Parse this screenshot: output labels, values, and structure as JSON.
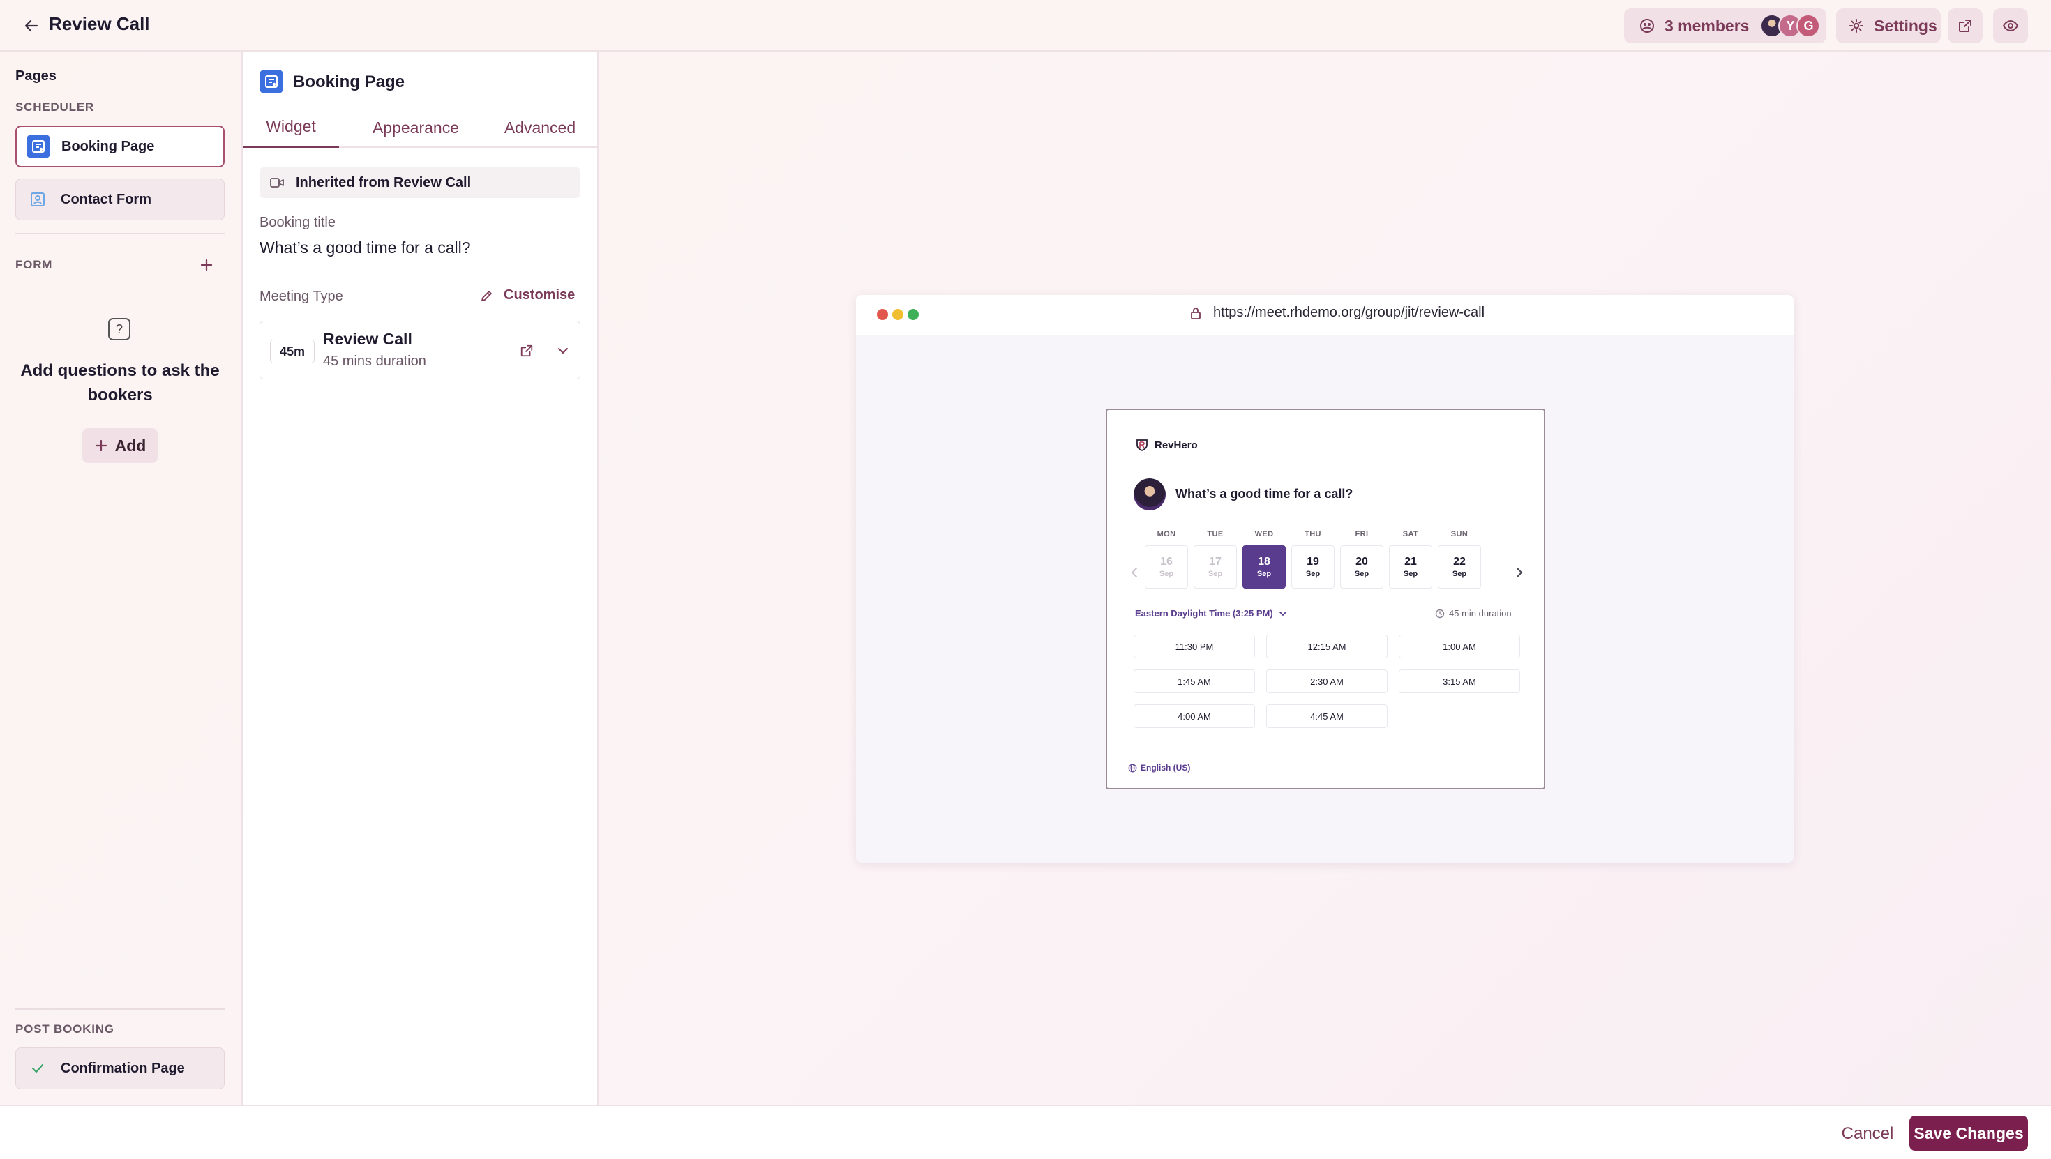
{
  "header": {
    "title": "Review Call",
    "members_label": "3 members",
    "avatars": [
      "",
      "Y",
      "G"
    ],
    "settings_label": "Settings"
  },
  "sidebar": {
    "pages_title": "Pages",
    "scheduler_label": "SCHEDULER",
    "items": [
      {
        "label": "Booking Page",
        "active": true
      },
      {
        "label": "Contact Form",
        "active": false
      }
    ],
    "form_label": "FORM",
    "empty_text": "Add questions to ask the bookers",
    "add_label": "Add",
    "post_booking_label": "POST BOOKING",
    "confirmation_label": "Confirmation Page"
  },
  "panel": {
    "title": "Booking Page",
    "tabs": [
      {
        "label": "Widget",
        "active": true
      },
      {
        "label": "Appearance",
        "active": false
      },
      {
        "label": "Advanced",
        "active": false
      }
    ],
    "inherited_text": "Inherited from Review Call",
    "booking_title_label": "Booking title",
    "booking_title_value": "What’s a good time for a call?",
    "meeting_type_label": "Meeting Type",
    "customise_label": "Customise",
    "meeting": {
      "duration_chip": "45m",
      "name": "Review Call",
      "duration_text": "45 mins duration"
    }
  },
  "preview": {
    "url": "https://meet.rhdemo.org/group/jit/review-call",
    "brand": "RevHero",
    "title": "What’s a good time for a call?",
    "days": [
      {
        "name": "MON",
        "num": "16",
        "mon": "Sep",
        "state": "disabled"
      },
      {
        "name": "TUE",
        "num": "17",
        "mon": "Sep",
        "state": "disabled"
      },
      {
        "name": "WED",
        "num": "18",
        "mon": "Sep",
        "state": "selected"
      },
      {
        "name": "THU",
        "num": "19",
        "mon": "Sep",
        "state": "normal"
      },
      {
        "name": "FRI",
        "num": "20",
        "mon": "Sep",
        "state": "normal"
      },
      {
        "name": "SAT",
        "num": "21",
        "mon": "Sep",
        "state": "normal"
      },
      {
        "name": "SUN",
        "num": "22",
        "mon": "Sep",
        "state": "normal"
      }
    ],
    "timezone": "Eastern Daylight Time (3:25 PM)",
    "duration": "45 min duration",
    "slots": [
      "11:30 PM",
      "12:15 AM",
      "1:00 AM",
      "1:45 AM",
      "2:30 AM",
      "3:15 AM",
      "4:00 AM",
      "4:45 AM"
    ],
    "language": "English (US)"
  },
  "footer": {
    "cancel_label": "Cancel",
    "save_label": "Save Changes"
  },
  "colors": {
    "accent": "#7b3a57",
    "primary_button": "#7a1f4e",
    "selected_day": "#5a3c8e",
    "booking_icon": "#3b6fe0"
  }
}
